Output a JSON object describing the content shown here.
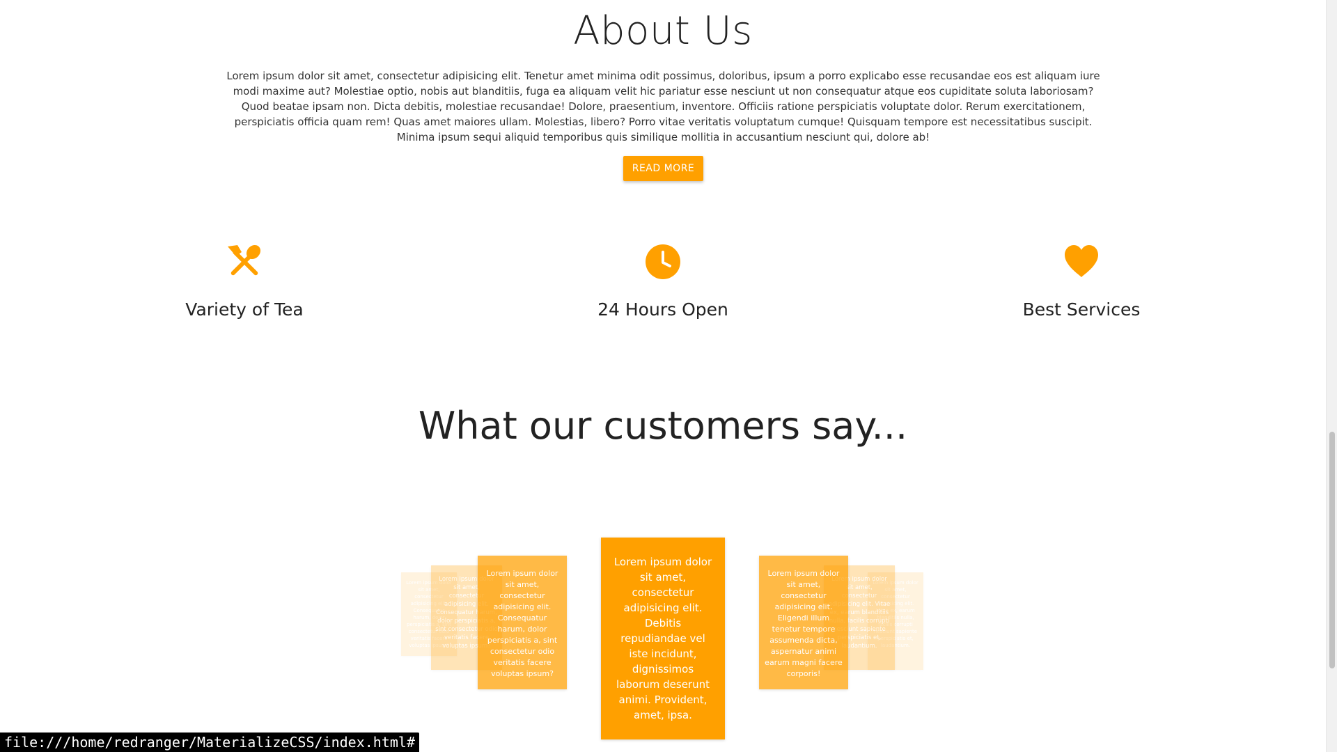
{
  "about": {
    "title": "About Us",
    "body": "Lorem ipsum dolor sit amet, consectetur adipisicing elit. Tenetur amet minima odit possimus, doloribus, ipsum a porro explicabo esse recusandae eos est aliquam iure modi maxime aut? Molestiae optio, nobis aut blanditiis, fuga ea aliquam velit hic pariatur esse nesciunt ut non consequatur atque eos cupiditate soluta laboriosam? Quod beatae ipsam non. Dicta debitis, molestiae recusandae! Dolore, praesentium, inventore. Officiis ratione perspiciatis voluptate dolor. Rerum exercitationem, perspiciatis officia quam rem! Quas amet maiores ullam. Molestias, libero? Porro vitae veritatis voluptatum cumque! Quisquam tempore est necessitatibus suscipit. Minima ipsum sequi aliquid temporibus quis similique mollitia in accusantium nesciunt qui, dolore ab!",
    "button_label": "READ MORE"
  },
  "features": [
    {
      "icon": "restaurant-icon",
      "label": "Variety of Tea"
    },
    {
      "icon": "clock-icon",
      "label": "24 Hours Open"
    },
    {
      "icon": "heart-icon",
      "label": "Best Services"
    }
  ],
  "accent_color": "#ffa000",
  "testimonials": {
    "title": "What our customers say...",
    "cards": [
      {
        "position": "far-left",
        "text": "Lorem ipsum dolor sit amet, consectetur adipisicing elit. Consequatur harum, dolor perspiciatis a, sint consectetur odio veritatis facere voluptas ipsum?"
      },
      {
        "position": "mid-left",
        "text": "Lorem ipsum dolor sit amet, consectetur adipisicing elit. Consequatur harum, dolor perspiciatis a, sint consectetur odio veritatis facere voluptas ipsum?"
      },
      {
        "position": "left",
        "text": "Lorem ipsum dolor sit amet, consectetur adipisicing elit. Consequatur harum, dolor perspiciatis a, sint consectetur odio veritatis facere voluptas ipsum?"
      },
      {
        "position": "center",
        "text": "Lorem ipsum dolor sit amet, consectetur adipisicing elit. Debitis repudiandae vel iste incidunt, dignissimos laborum deserunt animi. Provident, amet, ipsa."
      },
      {
        "position": "right",
        "text": "Lorem ipsum dolor sit amet, consectetur adipisicing elit. Eligendi illum tenetur tempore assumenda dicta, aspernatur animi earum magni facere corporis!"
      },
      {
        "position": "mid-right",
        "text": "Lorem ipsum dolor sit amet, consectetur adipisicing elit. Vitae ex, earum blanditiis nulla, facilis corrupti nesciunt sapiente perspiciatis et, laudantium."
      },
      {
        "position": "far-right",
        "text": "Lorem ipsum dolor sit amet, consectetur adipisicing elit. Vitae ex, earum blanditiis nulla, facilis corrupti nesciunt sapiente perspiciatis et, laudantium."
      }
    ]
  },
  "status_bar": {
    "url": "file:///home/redranger/MaterializeCSS/index.html#"
  }
}
